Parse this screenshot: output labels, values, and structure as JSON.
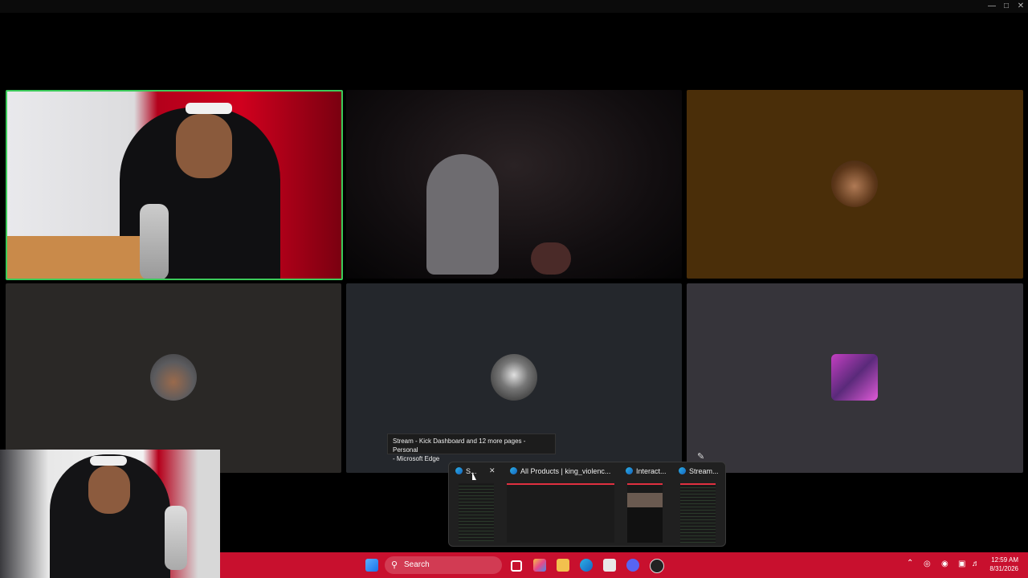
{
  "window": {
    "minimize_icon": "minimize-icon",
    "maximize_icon": "maximize-icon",
    "close_icon": "close-icon"
  },
  "participants": [
    {
      "kind": "video",
      "description_icon": "camera-feed",
      "active_speaker": true
    },
    {
      "kind": "video",
      "description_icon": "camera-feed"
    },
    {
      "kind": "avatar",
      "tile_color": "#4a2e09"
    },
    {
      "kind": "avatar",
      "tile_color": "#2a2826"
    },
    {
      "kind": "avatar",
      "tile_color": "#24272c"
    },
    {
      "kind": "avatar",
      "tile_color": "#36343a"
    }
  ],
  "tooltip": {
    "text_line1": "Stream - Kick Dashboard and 12 more pages - Personal",
    "text_line2": "- Microsoft Edge"
  },
  "thumbnails": [
    {
      "title": "S..."
    },
    {
      "title": "All Products | king_violenc..."
    },
    {
      "title": "Interact..."
    },
    {
      "title": "Stream..."
    }
  ],
  "taskbar": {
    "search_label": "Search",
    "time": "12:59 AM",
    "date": "8/31/2026",
    "accent": "#c8102e"
  }
}
